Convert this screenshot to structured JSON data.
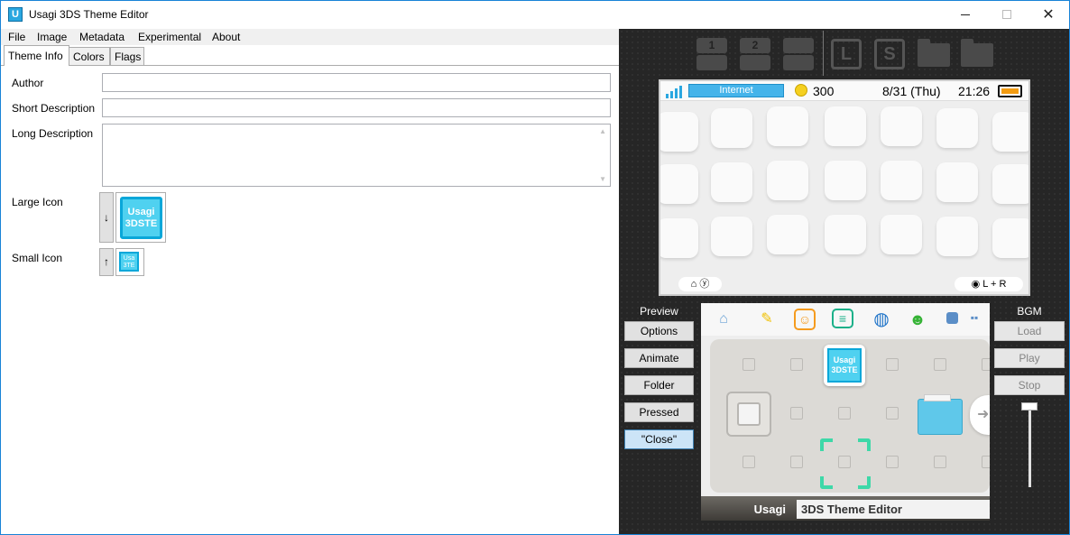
{
  "window": {
    "title": "Usagi 3DS Theme Editor",
    "app_icon_letter": "U",
    "accent": "#1883d7"
  },
  "menu": [
    "File",
    "Image",
    "Metadata",
    "Experimental",
    "About"
  ],
  "tabs": [
    {
      "label": "Theme Info",
      "active": true
    },
    {
      "label": "Colors",
      "active": false
    },
    {
      "label": "Flags",
      "active": false
    }
  ],
  "form": {
    "author_label": "Author",
    "author_value": "",
    "short_desc_label": "Short Description",
    "short_desc_value": "",
    "long_desc_label": "Long Description",
    "long_desc_value": "",
    "large_icon_label": "Large Icon",
    "large_icon_text_1": "Usagi",
    "large_icon_text_2": "3DSTE",
    "small_icon_label": "Small Icon",
    "small_icon_text_1": "Usa",
    "small_icon_text_2": "3TE",
    "down_arrow": "↓",
    "up_arrow": "↑"
  },
  "toolbar": {
    "slot_1": "1",
    "slot_2": "2",
    "letter_l": "L",
    "letter_s": "S"
  },
  "top_screen": {
    "internet_label": "Internet",
    "coins": "300",
    "date": "8/31 (Thu)",
    "time": "21:26",
    "left_hint": "⌂ ⓨ",
    "right_hint": "◉ L + R"
  },
  "preview": {
    "label": "Preview",
    "buttons": [
      "Options",
      "Animate",
      "Folder",
      "Pressed",
      "\"Close\""
    ]
  },
  "bgm": {
    "label": "BGM",
    "buttons": [
      "Load",
      "Play",
      "Stop"
    ]
  },
  "bottom_screen": {
    "title_left": "Usagi",
    "title_right": "3DS Theme Editor",
    "icon_text_1": "Usagi",
    "icon_text_2": "3DSTE"
  }
}
